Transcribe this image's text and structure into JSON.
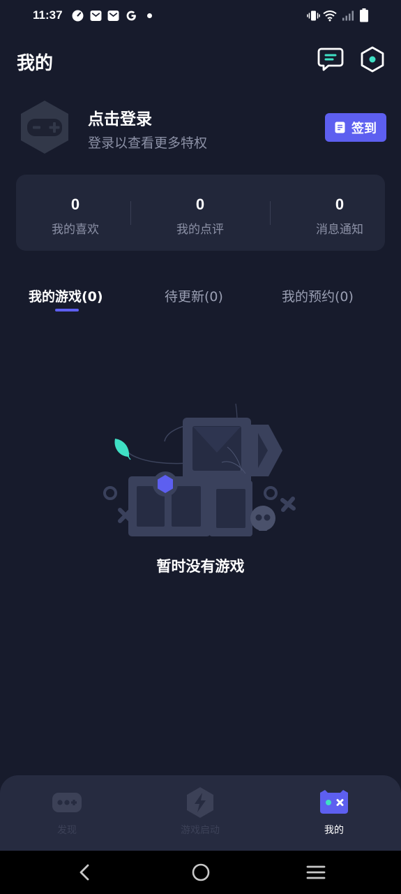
{
  "status_bar": {
    "time": "11:37",
    "left_icons": [
      "speed-icon",
      "mail-icon",
      "mail-icon",
      "google-icon",
      "dot-icon"
    ],
    "right_icons": [
      "vibrate-icon",
      "wifi-icon",
      "signal-icon",
      "battery-icon"
    ]
  },
  "header": {
    "title": "我的",
    "icons": [
      "message-icon",
      "settings-hex-icon"
    ]
  },
  "profile": {
    "login_title": "点击登录",
    "login_subtitle": "登录以查看更多特权",
    "signin_label": "签到"
  },
  "stats": [
    {
      "value": "0",
      "label": "我的喜欢"
    },
    {
      "value": "0",
      "label": "我的点评"
    },
    {
      "value": "0",
      "label": "消息通知"
    }
  ],
  "tabs": [
    {
      "label": "我的游戏(0)",
      "active": true
    },
    {
      "label": "待更新(0)",
      "active": false
    },
    {
      "label": "我的预约(0)",
      "active": false
    }
  ],
  "empty_state": {
    "text": "暂时没有游戏"
  },
  "bottom_nav": [
    {
      "label": "发现",
      "icon": "gamepad-icon",
      "active": false
    },
    {
      "label": "游戏启动",
      "icon": "lightning-icon",
      "active": false
    },
    {
      "label": "我的",
      "icon": "profile-controller-icon",
      "active": true
    }
  ],
  "system_nav": [
    "back-icon",
    "home-icon",
    "recents-icon"
  ],
  "colors": {
    "background": "#171b2c",
    "card": "#22273a",
    "accent": "#5d5ff0",
    "teal": "#3fe0c5",
    "muted_text": "#8c91a6"
  }
}
